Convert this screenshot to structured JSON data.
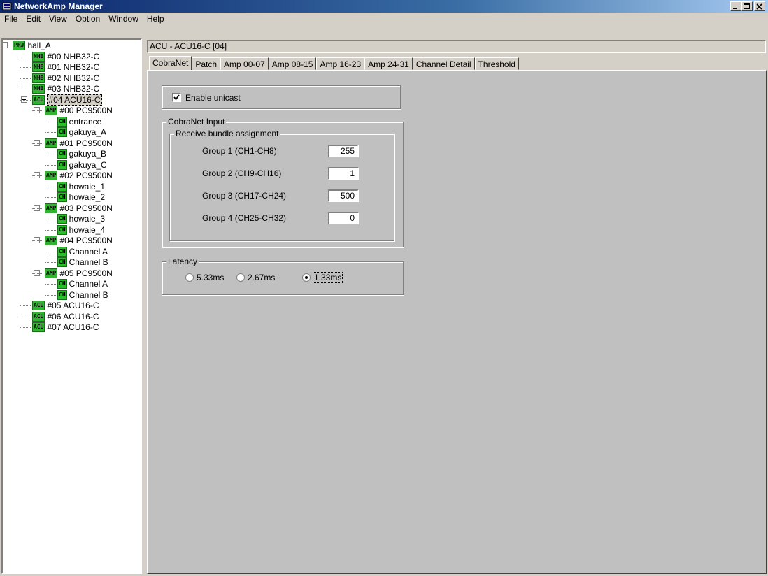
{
  "window": {
    "title": "NetworkAmp Manager"
  },
  "menu": [
    "File",
    "Edit",
    "View",
    "Option",
    "Window",
    "Help"
  ],
  "tree": [
    {
      "badge": "PRJ",
      "label": "hall_A"
    },
    {
      "badge": "NHB",
      "label": "#00 NHB32-C"
    },
    {
      "badge": "NHB",
      "label": "#01 NHB32-C"
    },
    {
      "badge": "NHB",
      "label": "#02 NHB32-C"
    },
    {
      "badge": "NHB",
      "label": "#03 NHB32-C"
    },
    {
      "badge": "ACU",
      "label": "#04 ACU16-C"
    },
    {
      "badge": "AMP",
      "label": "#00 PC9500N"
    },
    {
      "badge": "CH",
      "label": "entrance"
    },
    {
      "badge": "CH",
      "label": "gakuya_A"
    },
    {
      "badge": "AMP",
      "label": "#01 PC9500N"
    },
    {
      "badge": "CH",
      "label": "gakuya_B"
    },
    {
      "badge": "CH",
      "label": "gakuya_C"
    },
    {
      "badge": "AMP",
      "label": "#02 PC9500N"
    },
    {
      "badge": "CH",
      "label": "howaie_1"
    },
    {
      "badge": "CH",
      "label": "howaie_2"
    },
    {
      "badge": "AMP",
      "label": "#03 PC9500N"
    },
    {
      "badge": "CH",
      "label": "howaie_3"
    },
    {
      "badge": "CH",
      "label": "howaie_4"
    },
    {
      "badge": "AMP",
      "label": "#04 PC9500N"
    },
    {
      "badge": "CH",
      "label": "Channel A"
    },
    {
      "badge": "CH",
      "label": "Channel B"
    },
    {
      "badge": "AMP",
      "label": "#05 PC9500N"
    },
    {
      "badge": "CH",
      "label": "Channel A"
    },
    {
      "badge": "CH",
      "label": "Channel B"
    },
    {
      "badge": "ACU",
      "label": "#05 ACU16-C"
    },
    {
      "badge": "ACU",
      "label": "#06 ACU16-C"
    },
    {
      "badge": "ACU",
      "label": "#07 ACU16-C"
    }
  ],
  "header": {
    "title": "ACU - ACU16-C [04]"
  },
  "tabs": [
    "CobraNet",
    "Patch",
    "Amp 00-07",
    "Amp 08-15",
    "Amp 16-23",
    "Amp 24-31",
    "Channel Detail",
    "Threshold"
  ],
  "cobranet": {
    "enable_unicast_label": "Enable unicast",
    "enable_unicast_checked": true,
    "input_group_label": "CobraNet Input",
    "bundle_group_label": "Receive bundle assignment",
    "groups": [
      {
        "label": "Group 1 (CH1-CH8)",
        "value": "255"
      },
      {
        "label": "Group 2 (CH9-CH16)",
        "value": "1"
      },
      {
        "label": "Group 3 (CH17-CH24)",
        "value": "500"
      },
      {
        "label": "Group 4 (CH25-CH32)",
        "value": "0"
      }
    ],
    "latency_label": "Latency",
    "latency_options": [
      "5.33ms",
      "2.67ms",
      "1.33ms"
    ],
    "latency_selected": "1.33ms"
  }
}
